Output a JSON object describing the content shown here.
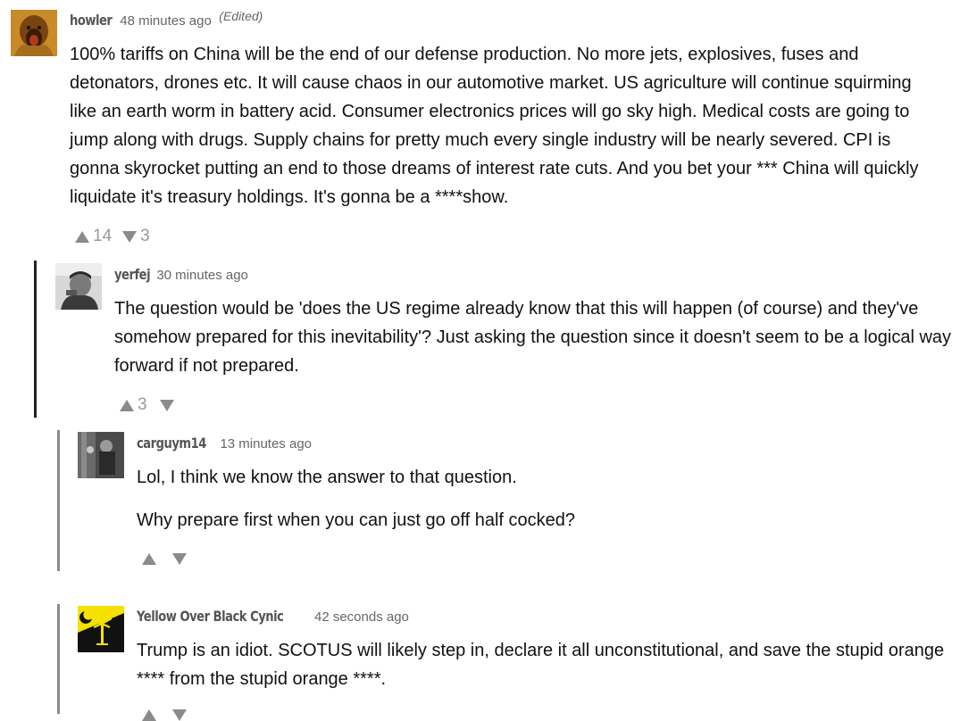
{
  "colors": {
    "rail_dark": "#222222",
    "rail_gray": "#8a8a8a",
    "vote_gray": "#8a8a8a",
    "text": "#111111",
    "muted": "#666666"
  },
  "comments": [
    {
      "user": "howler",
      "time": "48 minutes ago",
      "edited": "(Edited)",
      "avatar": "monkey-avatar",
      "paragraphs": [
        "100% tariffs on China will be the end of our defense production. No more jets, explosives, fuses and detonators, drones etc. It will cause chaos in our automotive market. US agriculture will continue squirming like an earth worm in battery acid. Consumer electronics prices will go sky high. Medical costs are going to jump along with drugs. Supply chains for pretty much every single industry will be nearly severed. CPI is gonna skyrocket putting an end to those dreams of interest rate cuts. And you bet your *** China will quickly liquidate it's treasury holdings. It's gonna be a ****show."
      ],
      "upvotes": "14",
      "downvotes": "3"
    },
    {
      "user": "yerfej",
      "time": "30 minutes ago",
      "avatar": "photo-avatar",
      "paragraphs": [
        "The question would be 'does the US regime already know that this will happen (of course) and they've somehow prepared for this inevitability'? Just asking the question since it doesn't seem to be a logical way forward if not prepared."
      ],
      "upvotes": "3",
      "downvotes": ""
    },
    {
      "user": "carguym14",
      "time": "13 minutes ago",
      "avatar": "photo-avatar",
      "paragraphs": [
        "Lol, I think we know the answer to that question.",
        "Why prepare first when you can just go off half cocked?"
      ],
      "upvotes": "",
      "downvotes": ""
    },
    {
      "user": "Yellow Over Black Cynic",
      "time": "42 seconds ago",
      "avatar": "palmetto-flag-avatar",
      "paragraphs": [
        "Trump is an idiot.  SCOTUS will likely step in, declare it all unconstitutional, and save the stupid orange **** from the stupid orange ****."
      ],
      "upvotes": "",
      "downvotes": ""
    }
  ]
}
